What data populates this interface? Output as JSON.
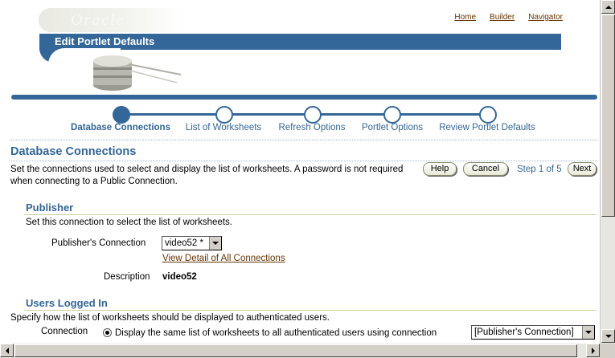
{
  "header": {
    "logo_text": "Oracle",
    "global_links": [
      "Home",
      "Builder",
      "Navigator"
    ],
    "page_title": "Edit Portlet Defaults"
  },
  "train": {
    "steps": [
      {
        "label": "Database Connections",
        "active": true
      },
      {
        "label": "List of Worksheets",
        "active": false
      },
      {
        "label": "Refresh Options",
        "active": false
      },
      {
        "label": "Portlet Options",
        "active": false
      },
      {
        "label": "Review Portlet Defaults",
        "active": false
      }
    ]
  },
  "section": {
    "title": "Database Connections",
    "instructions": "Set the connections used to select and display the list of worksheets. A password is not required when connecting to a Public Connection."
  },
  "nav": {
    "help_label": "Help",
    "cancel_label": "Cancel",
    "step_text": "Step 1 of 5",
    "next_label": "Next"
  },
  "publisher": {
    "heading": "Publisher",
    "description_text": "Set this connection to select the list of worksheets.",
    "connection_label": "Publisher's Connection",
    "connection_value": "video52 *",
    "detail_link": "View Detail of All Connections",
    "desc_label": "Description",
    "desc_value": "video52"
  },
  "users": {
    "heading": "Users Logged In",
    "description_text": "Specify how the list of worksheets should be displayed to authenticated users.",
    "connection_label": "Connection",
    "radio_label": "Display the same list of worksheets to all authenticated users using connection",
    "connection_value": "[Publisher's Connection]"
  },
  "colors": {
    "brand_blue": "#336699",
    "link_brown": "#663300"
  }
}
